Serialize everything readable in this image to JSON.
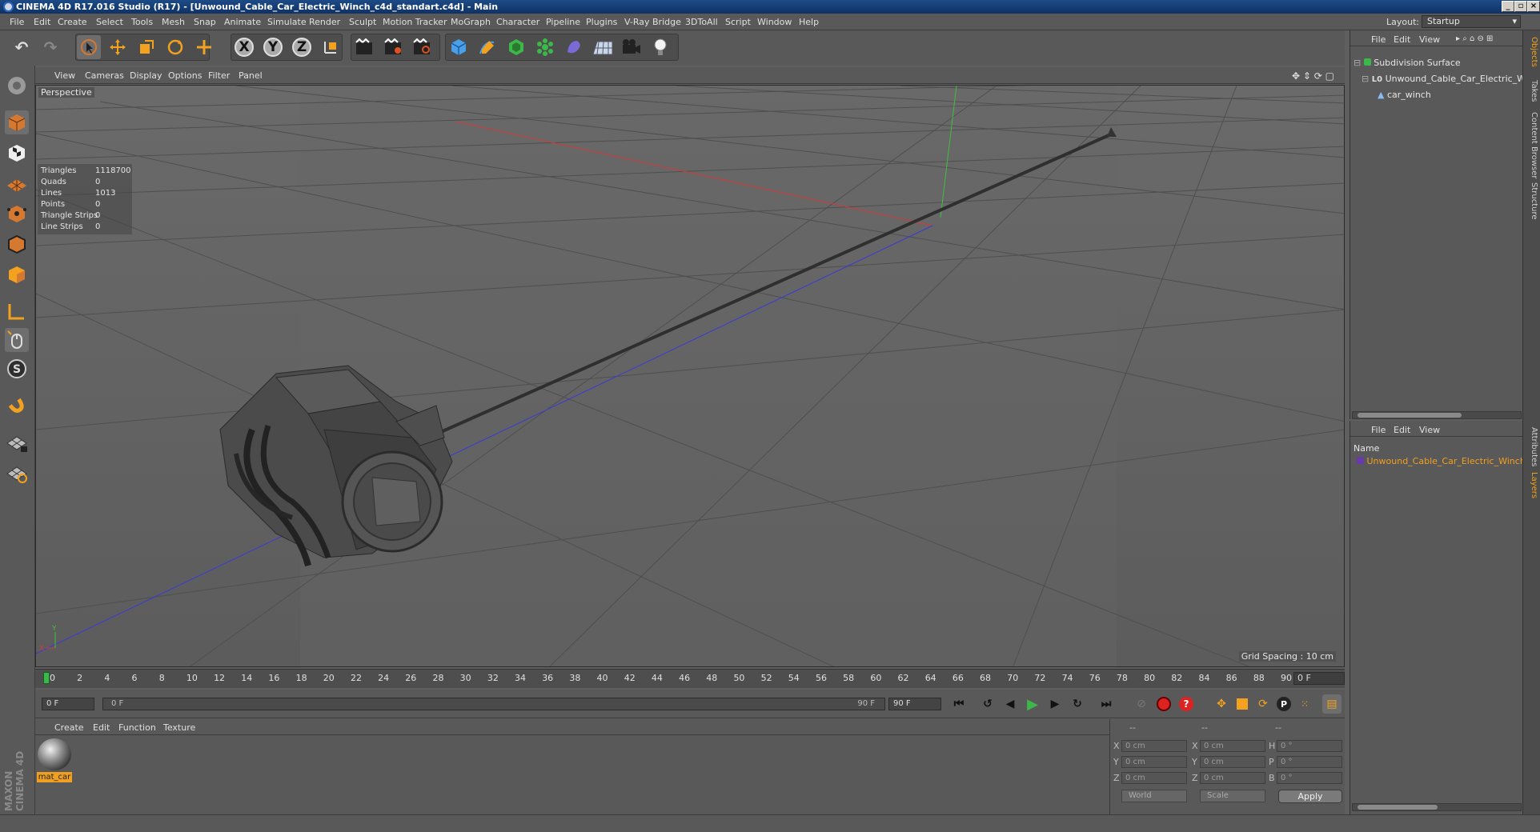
{
  "window": {
    "title": "CINEMA 4D R17.016 Studio (R17) - [Unwound_Cable_Car_Electric_Winch_c4d_standart.c4d] - Main"
  },
  "menubar": {
    "items": [
      "File",
      "Edit",
      "Create",
      "Select",
      "Tools",
      "Mesh",
      "Snap",
      "Animate",
      "Simulate",
      "Render",
      "Sculpt",
      "Motion Tracker",
      "MoGraph",
      "Character",
      "Pipeline",
      "Plugins",
      "V-Ray Bridge",
      "3DToAll",
      "Script",
      "Window",
      "Help"
    ],
    "layout_label": "Layout:",
    "layout_value": "Startup"
  },
  "toolbar": {
    "axis_x": "X",
    "axis_y": "Y",
    "axis_z": "Z"
  },
  "viewport": {
    "menu": [
      "View",
      "Cameras",
      "Display",
      "Options",
      "Filter",
      "Panel"
    ],
    "label": "Perspective",
    "grid_spacing": "Grid Spacing : 10 cm",
    "stats": [
      {
        "k": "Triangles",
        "v": "1118700"
      },
      {
        "k": "Quads",
        "v": "0"
      },
      {
        "k": "Lines",
        "v": "1013"
      },
      {
        "k": "Points",
        "v": "0"
      },
      {
        "k": "Triangle Strips",
        "v": "0"
      },
      {
        "k": "Line Strips",
        "v": "0"
      }
    ],
    "axis_colors": {
      "x": "#d23a3a",
      "y": "#3fbf3f",
      "z": "#3a3ad6"
    }
  },
  "timeline": {
    "ticks": [
      "0",
      "2",
      "4",
      "6",
      "8",
      "10",
      "12",
      "14",
      "16",
      "18",
      "20",
      "22",
      "24",
      "26",
      "28",
      "30",
      "32",
      "34",
      "36",
      "38",
      "40",
      "42",
      "44",
      "46",
      "48",
      "50",
      "52",
      "54",
      "56",
      "58",
      "60",
      "62",
      "64",
      "66",
      "68",
      "70",
      "72",
      "74",
      "76",
      "78",
      "80",
      "82",
      "84",
      "86",
      "88",
      "90"
    ],
    "current_frame": "0 F",
    "start_field": "0 F",
    "range_start": "0 F",
    "range_end": "90 F",
    "end_field": "90 F"
  },
  "material_manager": {
    "menu": [
      "Create",
      "Edit",
      "Function",
      "Texture"
    ],
    "material_name": "mat_car"
  },
  "coordinates": {
    "headers": [
      "--",
      "--",
      "--"
    ],
    "rows": [
      {
        "a": "X",
        "av": "0 cm",
        "b": "X",
        "bv": "0 cm",
        "c": "H",
        "cv": "0 °"
      },
      {
        "a": "Y",
        "av": "0 cm",
        "b": "Y",
        "bv": "0 cm",
        "c": "P",
        "cv": "0 °"
      },
      {
        "a": "Z",
        "av": "0 cm",
        "b": "Z",
        "bv": "0 cm",
        "c": "B",
        "cv": "0 °"
      }
    ],
    "world": "World",
    "scale": "Scale",
    "apply": "Apply"
  },
  "object_manager": {
    "menu": [
      "File",
      "Edit",
      "View"
    ],
    "objects": [
      "Subdivision Surface",
      "Unwound_Cable_Car_Electric_Winc",
      "car_winch"
    ]
  },
  "layer_manager": {
    "menu": [
      "File",
      "Edit",
      "View"
    ],
    "column": "Name",
    "layer": "Unwound_Cable_Car_Electric_Winch",
    "layer_color": "#f0a020"
  },
  "right_tabs": [
    "Objects",
    "Takes",
    "Content Browser",
    "Structure",
    "Attributes",
    "Layers"
  ],
  "brand": "MAXON CINEMA 4D"
}
